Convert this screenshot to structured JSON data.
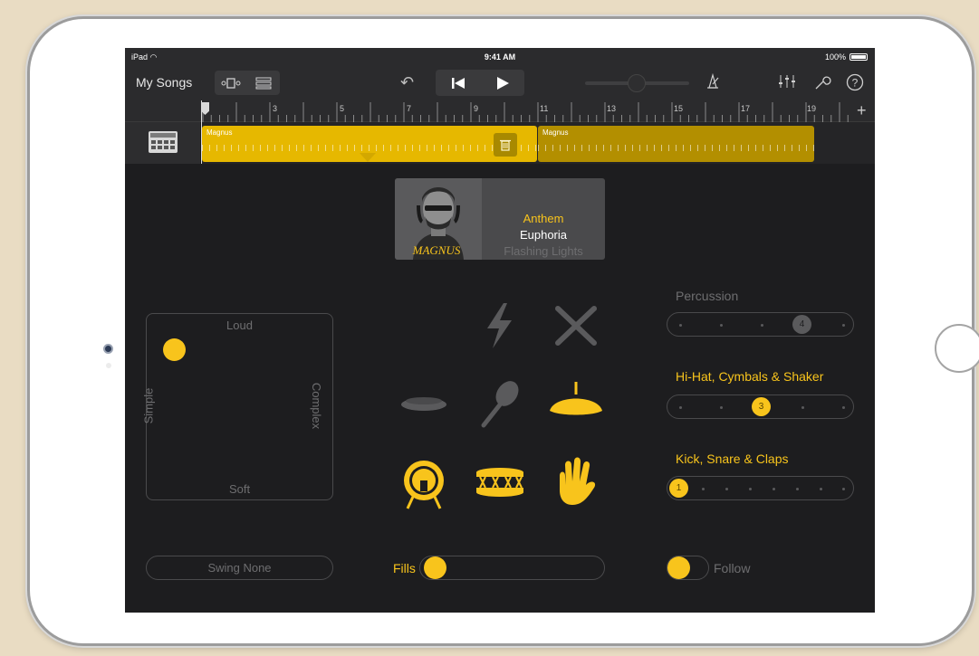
{
  "status_bar": {
    "device": "iPad",
    "time": "9:41 AM",
    "battery": "100%"
  },
  "toolbar": {
    "my_songs_label": "My Songs"
  },
  "ruler": {
    "bars": [
      "1",
      "3",
      "5",
      "7",
      "9",
      "11",
      "13",
      "15",
      "17",
      "19"
    ],
    "add_label": "+"
  },
  "track": {
    "regions": [
      {
        "name": "Magnus",
        "selected": true
      },
      {
        "name": "Magnus",
        "selected": false
      }
    ]
  },
  "drummer": {
    "signature": "MAGNUS",
    "genres": [
      "Anthem",
      "Euphoria",
      "Flashing Lights"
    ],
    "selected_genre": "Anthem"
  },
  "pad": {
    "top": "Loud",
    "bottom": "Soft",
    "left": "Simple",
    "right": "Complex"
  },
  "instruments": [
    "lightning-icon",
    "drumsticks-icon",
    "hihat-closed-icon",
    "maraca-icon",
    "crash-cymbal-icon",
    "kick-drum-icon",
    "snare-drum-icon",
    "clap-hand-icon"
  ],
  "sliders": [
    {
      "label": "Percussion",
      "value": "4",
      "active": false
    },
    {
      "label": "Hi-Hat, Cymbals & Shaker",
      "value": "3",
      "active": true
    },
    {
      "label": "Kick, Snare & Claps",
      "value": "1",
      "active": true
    }
  ],
  "bottom": {
    "swing_label": "Swing None",
    "fills_label": "Fills",
    "follow_label": "Follow"
  },
  "colors": {
    "accent": "#f8c41c",
    "region_selected": "#e6b800",
    "region": "#b38f00",
    "background": "#1d1d1f"
  }
}
